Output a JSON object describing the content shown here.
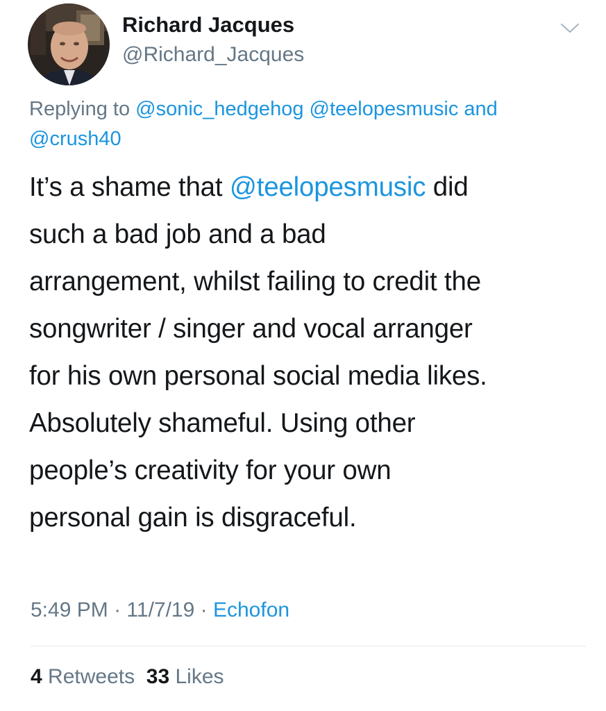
{
  "tweet": {
    "author": {
      "name": "Richard Jacques",
      "handle": "@Richard_Jacques"
    },
    "replying_to": {
      "prefix": "Replying to",
      "mentions": [
        "@sonic_hedgehog",
        "@teelopesmusic",
        "@crush40"
      ],
      "conjunction": "and"
    },
    "text_lines": [
      {
        "before": "It’s a shame that ",
        "mention": "@teelopesmusic",
        "after": " did"
      },
      "such a bad job and a bad",
      "arrangement, whilst failing to credit the",
      "songwriter / singer and vocal arranger",
      "for his own personal social media likes.",
      "Absolutely shameful. Using other",
      "people’s creativity for your own",
      "personal gain is disgraceful."
    ],
    "time": "5:49 PM",
    "date": "11/7/19",
    "separator": "·",
    "source": "Echofon",
    "retweets": {
      "count": "4",
      "label": "Retweets"
    },
    "likes": {
      "count": "33",
      "label": "Likes"
    }
  },
  "icons": {
    "menu": "chevron-down-icon",
    "avatar": "avatar"
  },
  "colors": {
    "link": "#1b95e0",
    "secondary_text": "#657786",
    "primary_text": "#14171a",
    "divider": "#e1e8ed"
  }
}
